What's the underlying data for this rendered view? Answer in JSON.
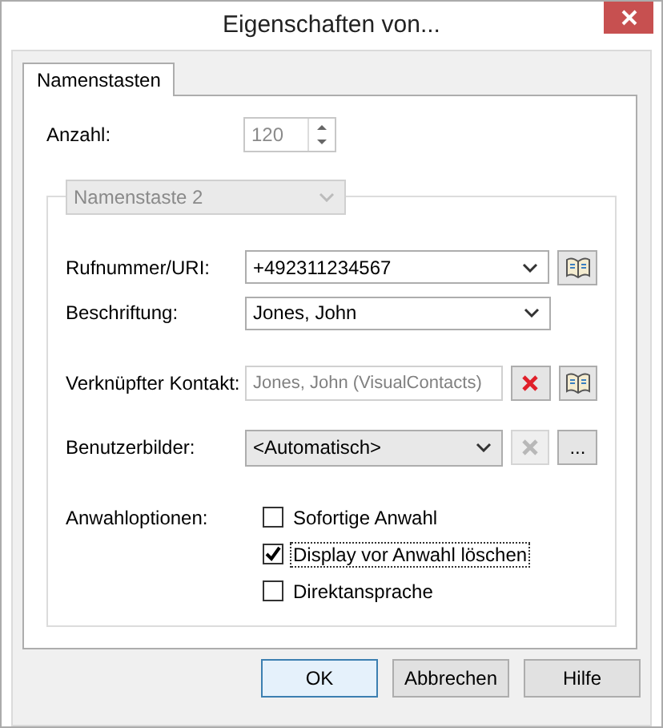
{
  "window": {
    "title": "Eigenschaften von..."
  },
  "tabs": [
    {
      "label": "Namenstasten",
      "selected": true
    }
  ],
  "count": {
    "label": "Anzahl:",
    "value": "120",
    "disabled": true
  },
  "group": {
    "selector": "Namenstaste 2",
    "disabled": true
  },
  "fields": [
    {
      "kind": "combo",
      "label": "Rufnummer/URI:",
      "value": "+492311234567",
      "readonly": false,
      "actions": [
        {
          "kind": "book",
          "disabled": false
        }
      ]
    },
    {
      "kind": "combo",
      "label": "Beschriftung:",
      "value": "Jones, John",
      "readonly": false
    },
    {
      "kind": "text",
      "label": "Verknüpfter Kontakt:",
      "value": "Jones, John (VisualContacts)",
      "readonly": true,
      "actions": [
        {
          "kind": "clear",
          "disabled": false
        },
        {
          "kind": "book",
          "disabled": false
        }
      ]
    },
    {
      "kind": "combo",
      "label": "Benutzerbilder:",
      "value": "<Automatisch>",
      "readonly": false,
      "actions": [
        {
          "kind": "clear",
          "disabled": true
        },
        {
          "kind": "more",
          "label": "...",
          "disabled": false
        }
      ]
    }
  ],
  "options": {
    "label": "Anwahloptionen:",
    "items": [
      {
        "label": "Sofortige Anwahl",
        "checked": false,
        "focused": false
      },
      {
        "label": "Display vor Anwahl löschen",
        "checked": true,
        "focused": true
      },
      {
        "label": "Direktansprache",
        "checked": false,
        "focused": false
      }
    ]
  },
  "buttons": [
    {
      "label": "OK",
      "default": true
    },
    {
      "label": "Abbrechen",
      "default": false
    },
    {
      "label": "Hilfe",
      "default": false
    }
  ]
}
